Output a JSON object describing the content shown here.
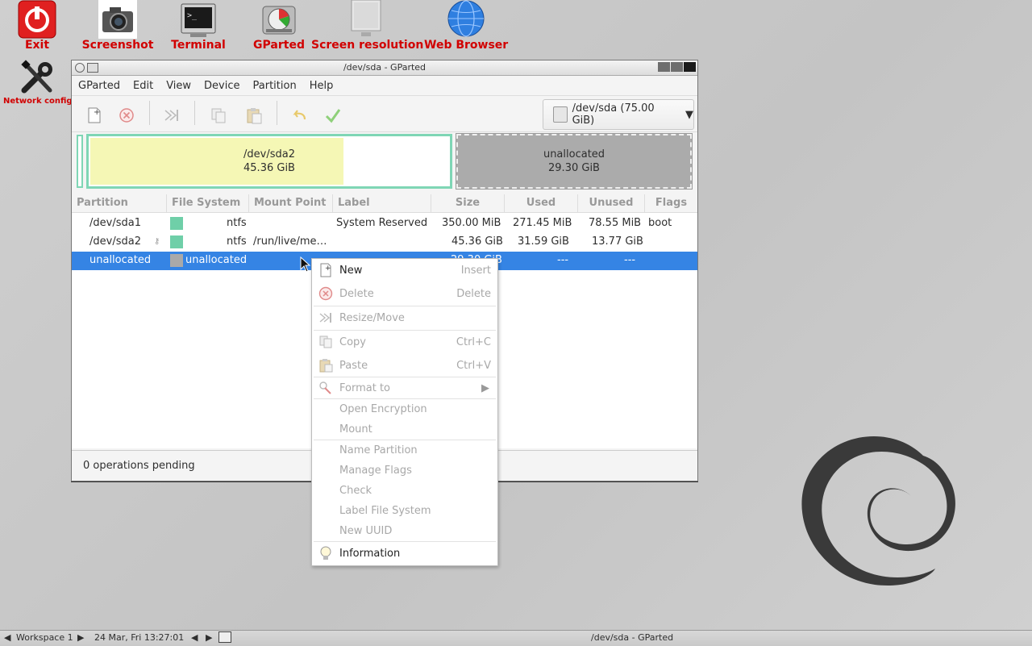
{
  "desktop": {
    "icons": [
      {
        "label": "Exit"
      },
      {
        "label": "Screenshot"
      },
      {
        "label": "Terminal"
      },
      {
        "label": "GParted"
      },
      {
        "label": "Screen resolution"
      },
      {
        "label": "Web Browser"
      },
      {
        "label": "Network config"
      }
    ]
  },
  "window": {
    "title": "/dev/sda - GParted",
    "menu": [
      "GParted",
      "Edit",
      "View",
      "Device",
      "Partition",
      "Help"
    ],
    "device_selector": "/dev/sda  (75.00 GiB)",
    "diskmap": {
      "sda2_name": "/dev/sda2",
      "sda2_size": "45.36 GiB",
      "unalloc_name": "unallocated",
      "unalloc_size": "29.30 GiB",
      "sda2_used_fraction": 0.7
    },
    "columns": [
      "Partition",
      "File System",
      "Mount Point",
      "Label",
      "Size",
      "Used",
      "Unused",
      "Flags"
    ],
    "rows": [
      {
        "partition": "/dev/sda1",
        "fs": "ntfs",
        "mount": "",
        "label": "System Reserved",
        "size": "350.00 MiB",
        "used": "271.45 MiB",
        "unused": "78.55 MiB",
        "flags": "boot",
        "color": "#6fcfa8"
      },
      {
        "partition": "/dev/sda2",
        "fs": "ntfs",
        "mount": "/run/live/me…",
        "label": "",
        "size": "45.36 GiB",
        "used": "31.59 GiB",
        "unused": "13.77 GiB",
        "flags": "",
        "color": "#6fcfa8"
      },
      {
        "partition": "unallocated",
        "fs": "unallocated",
        "mount": "",
        "label": "",
        "size": "29.30 GiB",
        "used": "---",
        "unused": "---",
        "flags": "",
        "color": "#a9a9a9"
      }
    ],
    "status": "0 operations pending"
  },
  "context_menu": {
    "items": [
      {
        "label": "New",
        "key": "Insert"
      },
      {
        "label": "Delete",
        "key": "Delete"
      },
      {
        "label": "Resize/Move",
        "key": ""
      },
      {
        "label": "Copy",
        "key": "Ctrl+C"
      },
      {
        "label": "Paste",
        "key": "Ctrl+V"
      },
      {
        "label": "Format to",
        "key": ""
      },
      {
        "label": "Open Encryption",
        "key": ""
      },
      {
        "label": "Mount",
        "key": ""
      },
      {
        "label": "Name Partition",
        "key": ""
      },
      {
        "label": "Manage Flags",
        "key": ""
      },
      {
        "label": "Check",
        "key": ""
      },
      {
        "label": "Label File System",
        "key": ""
      },
      {
        "label": "New UUID",
        "key": ""
      },
      {
        "label": "Information",
        "key": ""
      }
    ]
  },
  "taskbar": {
    "workspace": "Workspace 1",
    "clock": "24 Mar, Fri 13:27:01",
    "task": "/dev/sda - GParted"
  }
}
